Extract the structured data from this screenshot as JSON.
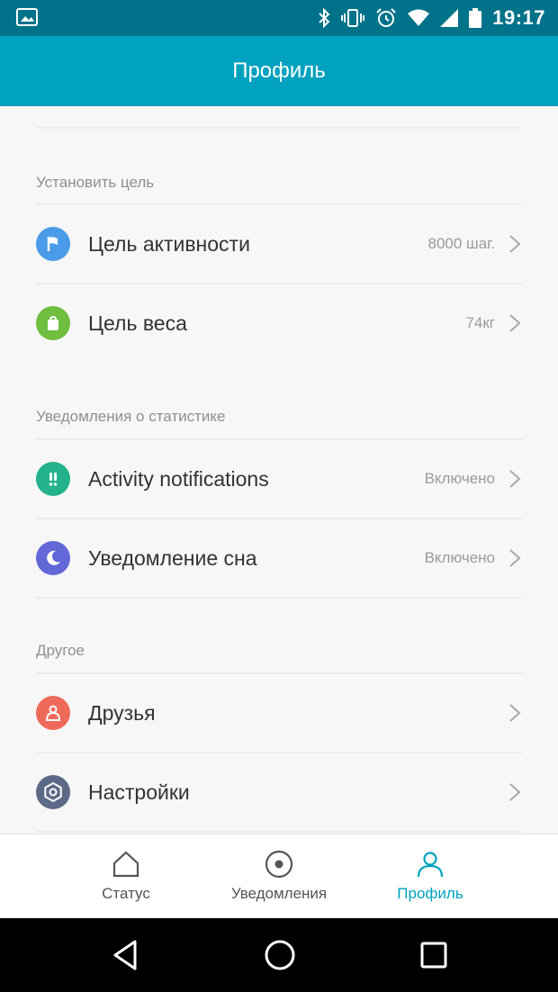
{
  "status_bar": {
    "time": "19:17",
    "icons": [
      "image-notification-icon",
      "bluetooth-icon",
      "vibrate-icon",
      "alarm-icon",
      "wifi-icon",
      "cell-signal-icon",
      "battery-icon"
    ]
  },
  "app_bar": {
    "title": "Профиль"
  },
  "sections": [
    {
      "header": "Установить цель",
      "items": [
        {
          "label": "Цель активности",
          "value": "8000 шаг.",
          "icon": "flag-icon",
          "color": "#4a9be8"
        },
        {
          "label": "Цель веса",
          "value": "74кг",
          "icon": "weight-icon",
          "color": "#6fbe3f"
        }
      ]
    },
    {
      "header": "Уведомления о статистике",
      "items": [
        {
          "label": "Activity notifications",
          "value": "Включено",
          "icon": "alert-icon",
          "color": "#22b38c"
        },
        {
          "label": "Уведомление сна",
          "value": "Включено",
          "icon": "moon-icon",
          "color": "#6268d8"
        }
      ]
    },
    {
      "header": "Другое",
      "items": [
        {
          "label": "Друзья",
          "value": "",
          "icon": "friends-icon",
          "color": "#f06a5a"
        },
        {
          "label": "Настройки",
          "value": "",
          "icon": "settings-icon",
          "color": "#5d6a87"
        }
      ]
    }
  ],
  "bottom_nav": {
    "tabs": [
      {
        "label": "Статус",
        "icon": "home-icon",
        "active": false
      },
      {
        "label": "Уведомления",
        "icon": "notifications-icon",
        "active": false
      },
      {
        "label": "Профиль",
        "icon": "profile-icon",
        "active": true
      }
    ],
    "active_color": "#00a2bf"
  },
  "colors": {
    "status_bar": "#00728a",
    "app_bar": "#00a2bf",
    "background": "#f7f7f7"
  }
}
